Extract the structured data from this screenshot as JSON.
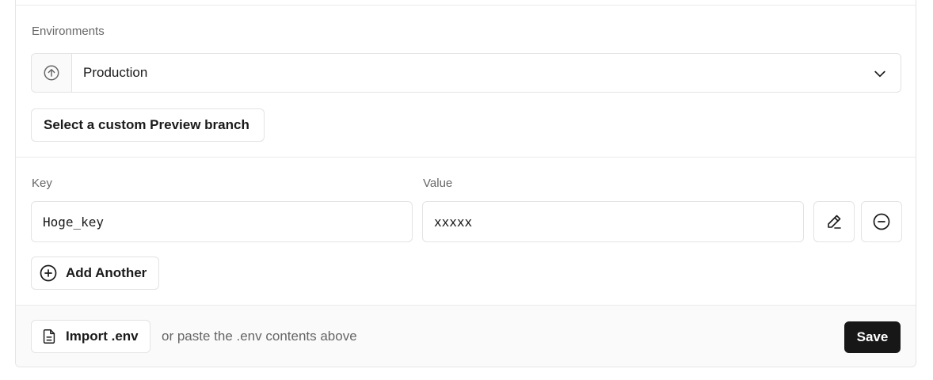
{
  "environments": {
    "label": "Environments",
    "selected": "Production",
    "prefix_icon": "arrow-up-circle-icon",
    "chevron_icon": "chevron-down-icon",
    "custom_branch_button": "Select a custom Preview branch"
  },
  "env_vars": {
    "key_label": "Key",
    "value_label": "Value",
    "rows": [
      {
        "key": "Hoge_key",
        "value": "xxxxx"
      }
    ],
    "edit_icon": "pencil-icon",
    "remove_icon": "minus-circle-icon",
    "add_another_label": "Add Another",
    "add_icon": "plus-circle-icon"
  },
  "footer": {
    "import_label": "Import .env",
    "import_icon": "file-icon",
    "hint": "or paste the .env contents above",
    "save_label": "Save"
  },
  "colors": {
    "primary_button_bg": "#171717",
    "border": "#e3e3e3",
    "muted_text": "#666666",
    "footer_bg": "#fafafa"
  }
}
